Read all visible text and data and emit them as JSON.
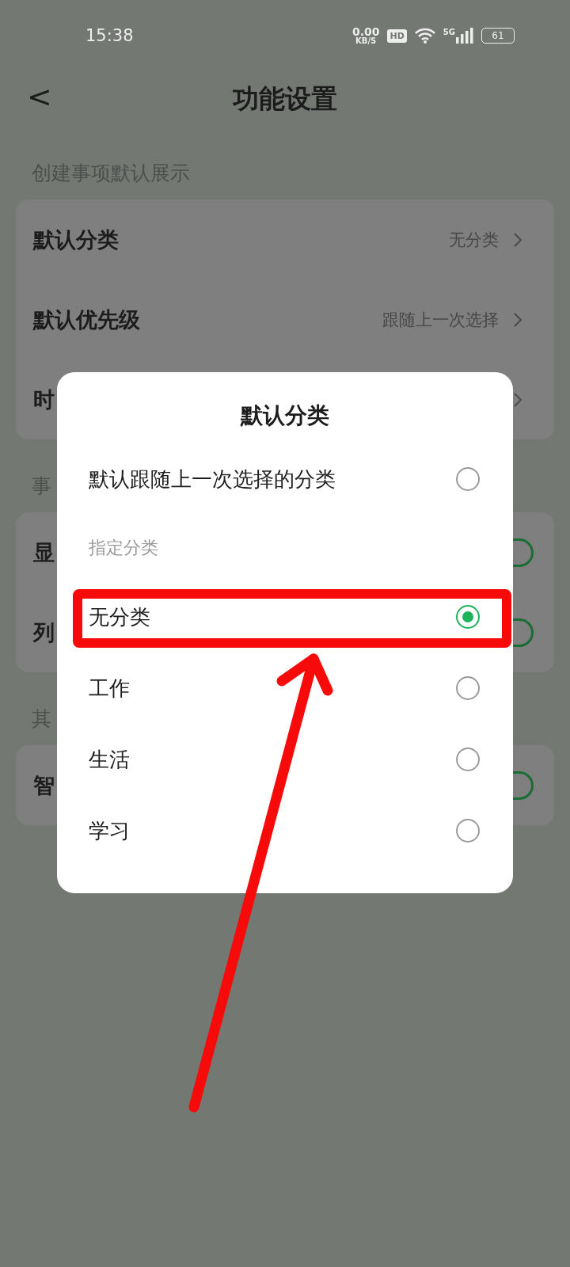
{
  "status_bar": {
    "time": "15:38",
    "net_speed": "0.00",
    "net_unit": "KB/S",
    "hd": "HD",
    "network": "5G",
    "battery": "61"
  },
  "header": {
    "back": "<",
    "title": "功能设置"
  },
  "sections": [
    {
      "label": "创建事项默认展示",
      "rows": [
        {
          "kind": "link",
          "label": "默认分类",
          "value": "无分类"
        },
        {
          "kind": "link",
          "label": "默认优先级",
          "value": "跟随上一次选择"
        },
        {
          "kind": "link",
          "label": "时"
        }
      ]
    },
    {
      "label": "事",
      "rows": [
        {
          "kind": "toggle",
          "label": "显",
          "on": true
        },
        {
          "kind": "toggle",
          "label": "列",
          "on": true
        }
      ]
    },
    {
      "label": "其",
      "rows": [
        {
          "kind": "toggle",
          "label": "智",
          "on": true
        }
      ]
    }
  ],
  "dialog": {
    "title": "默认分类",
    "items": [
      {
        "kind": "option",
        "label": "默认跟随上一次选择的分类",
        "selected": false
      },
      {
        "kind": "subheader",
        "label": "指定分类"
      },
      {
        "kind": "option",
        "label": "无分类",
        "selected": true
      },
      {
        "kind": "option",
        "label": "工作",
        "selected": false
      },
      {
        "kind": "option",
        "label": "生活",
        "selected": false
      },
      {
        "kind": "option",
        "label": "学习",
        "selected": false
      }
    ]
  }
}
